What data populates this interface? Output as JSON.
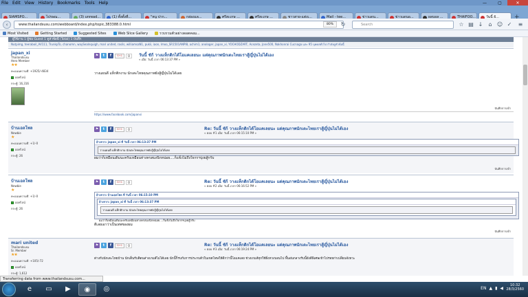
{
  "browser": {
    "menu": [
      "File",
      "Edit",
      "View",
      "History",
      "Bookmarks",
      "Tools",
      "Help"
    ],
    "tabs": [
      {
        "label": "SIAMSPO...",
        "color": "#c33"
      },
      {
        "label": "ไปรษณ...",
        "color": "#c33"
      },
      {
        "label": "(3) unread...",
        "color": "#6a6"
      },
      {
        "label": "(1) ทั้งตั้งที่...",
        "color": "#36c"
      },
      {
        "label": "\"หนู ปาก...",
        "color": "#c33"
      },
      {
        "label": "กล่องแล...",
        "color": "#c63"
      },
      {
        "label": "ศรีสะเกษ ...",
        "color": "#333"
      },
      {
        "label": "ศรีสะเกษ ...",
        "color": "#333"
      },
      {
        "label": "ชาวสาย-แต่งเ...",
        "color": "#888"
      },
      {
        "label": "Mail - tee...",
        "color": "#36c"
      },
      {
        "label": "ข่าวแดน...",
        "color": "#c33"
      },
      {
        "label": "ข่าวแดนอ...",
        "color": "#c33"
      },
      {
        "label": "ผลบอล ...",
        "color": "#333"
      },
      {
        "label": "THAIFOO...",
        "color": "#c33"
      },
      {
        "label": "วันนี้ ยั...",
        "color": "#c33"
      }
    ],
    "url": "www.thailandsusu.com/webboard/index.php/topic,383388.0.html",
    "zoom": "80%",
    "search_placeholder": "Search",
    "bookmarks": [
      "Most Visited",
      "Getting Started",
      "Suggested Sites",
      "Web Slice Gallery",
      "รวบรวมตัวอย่างดอตคอม..."
    ],
    "window_controls": {
      "minimize": "—",
      "maximize": "▢",
      "close": "✕"
    },
    "status": "Transferring data from www.thailandsusu.com..."
  },
  "forum": {
    "header": "ผู้ใช้งาน 1 ผู้ชม Guest 1 ดูหัวข้อนี้ (Total) 1 บันทึก",
    "online_users": "Nutpimg, teeraboil_AV111, TrunkpTo, chanomn, waySealnquigh, mari united, rasils, williamsaN1, pukii, iaon, lmoo_SR1501ANPI8, achim1, anologer, japan_xi, YOCHODZART, Acezeta, Jone500, Nakhonrai Cucnaga และ 95 บุคคลทั่วไป กำลังดูหัวข้อนี้",
    "posts": [
      {
        "author": "japan_xi",
        "author_sub": "Thailandsusu",
        "rank": "Hero Member",
        "stars": "★★",
        "points": "คะแนนความดี: +1925/-4834",
        "online": "ออฟไลน์",
        "post_count": "กระทู้: 16,316",
        "title": "วันนี้ ชัก้ วางแท็กติกได้โอแคเลยนะ แต่คุณภาพนักเตะไทยเราสู้ญี่ปุ่นไม่ได้เอง",
        "meta": "« เมื่อ: วันนี้ เวลา 06:13:37 PM »",
        "body": "วางแผนดี แท็กติกงาม นักเตะไทยคุณภาพยังสู้ญี่ปุ่นไม่ได้เลย",
        "signature": "https://www.facebook.com/japanxi",
        "report": "บันทึกการเข้า"
      },
      {
        "author": "บ้านเอลโพล",
        "author_sub": "Newbie",
        "rank": "",
        "stars": "★",
        "points": "คะแนนความดี: +1/-0",
        "online": "ออฟไลน์",
        "post_count": "กระทู้: 26",
        "title": "Re: วันนี้ ชัก้ วางแท็กติกได้โอแคเลยนะ แต่คุณภาพนักเตะไทยเราสู้ญี่ปุ่นไม่ได้เอง",
        "meta": "« ตอบ #1 เมื่อ: วันนี้ เวลา 06:15:10 PM »",
        "quote_header": "อ้างจาก: japan_xi ที่ วันนี้ เวลา 06:13:37 PM",
        "quote_body": "วางแผนดี แท็กติกงาม นักเตะไทยคุณภาพยังสู้ญี่ปุ่นไม่ได้เลย",
        "body": "ผมว่าก็เหมือนเดิมนะครับเหมือนห่างครสมงนิกหน่อย....ก็แข็งไม่ถึงใจกรฯบุ่งยสู้กรับ",
        "report": "บันทึกการเข้า"
      },
      {
        "author": "บ้านเอลโพล",
        "author_sub": "Newbie",
        "rank": "",
        "stars": "★",
        "points": "คะแนนความดี: +1/-0",
        "online": "ออฟไลน์",
        "post_count": "กระทู้: 26",
        "title": "Re: วันนี้ ชัก้ วางแท็กติกได้โอแคเลยนะ แต่คุณภาพนักเตะไทยเราสู้ญี่ปุ่นไม่ได้เอง",
        "meta": "« ตอบ #2 เมื่อ: วันนี้ เวลา 06:16:52 PM »",
        "quote_header": "อ้างจาก: บ้านเอลโพล ที่ วันนี้ เวลา 06:15:10 PM",
        "quote_inner_header": "อ้างจาก: japan_xi ที่ วันนี้ เวลา 06:13:37 PM",
        "quote_inner_body": "วางแผนดี แท็กติกงาม นักเตะไทยคุณภาพยังสู้ญี่ปุ่นไม่ได้เลย",
        "quote_body": "ผมว่าก็เหมือนเดิมนะครับเหมือนห่างครสมงนิกหน่อย....ก็แข็งไม่ถึงใจกรฯบุ่งยสู้กรับ",
        "body": "ดีเลยเอาว่าเป็นเทพของผม",
        "report": "บันทึกการเข้า"
      },
      {
        "author": "mari united",
        "author_sub": "Thailandsusu",
        "rank": "Sr. Member",
        "stars": "★★",
        "points": "คะแนนความดี: +105/-72",
        "online": "ออฟไลน์",
        "post_count": "กระทู้: 1,612",
        "title": "Re: วันนี้ ชัก้ วางแท็กติกได้โอแคเลยนะ แต่คุณภาพนักเตะไทยเราสู้ญี่ปุ่นไม่ได้เอง",
        "meta": "« ตอบ #3 เมื่อ: วันนี้ เวลา 06:19:24 PM »",
        "body": "ต่างกับนักเตะไทยบ้าน นักเต็นรับติดนส่างเกมส์ไม่ได้เลย นักนี้ก็รบกับการประกบตัวในเขตโทษให้ดีกว่านี้โอแคเลย ช่วงเกมส์ทุกใช้ฝั่งหวงบอนไป พื้นอ่นกลางรับนี้ยังดีพิเศษเข้าไปรทยก่าเปลี่ยนจังหวะ"
      }
    ],
    "social_labels": {
      "gplus": "G+1",
      "count": "0"
    }
  },
  "taskbar": {
    "lang": "EN",
    "time": "10:32",
    "date": "28/3/2560"
  }
}
